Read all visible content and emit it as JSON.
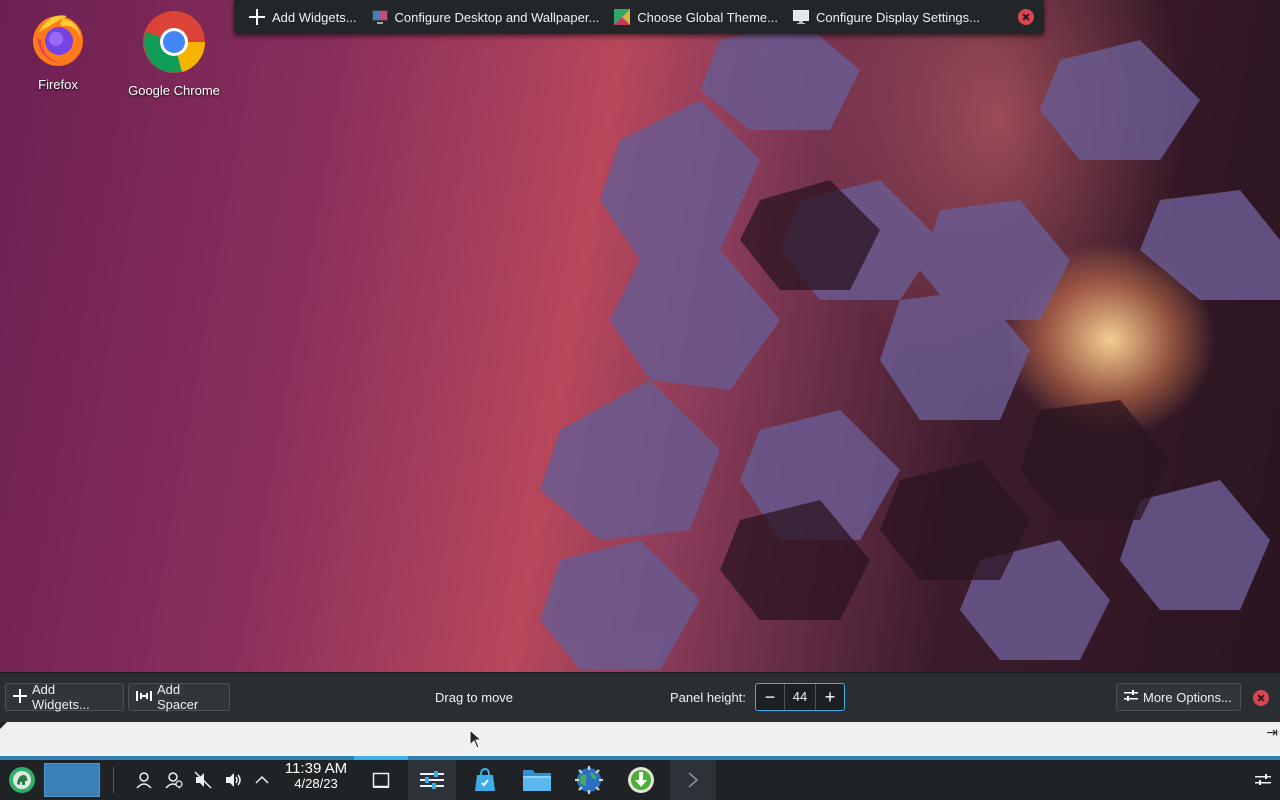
{
  "desktop": {
    "icons": [
      {
        "label": "Firefox",
        "icon": "firefox-icon"
      },
      {
        "label": "Google Chrome",
        "icon": "chrome-icon"
      }
    ]
  },
  "top_toolbar": {
    "add_widgets": "Add Widgets...",
    "configure_desktop": "Configure Desktop and Wallpaper...",
    "global_theme": "Choose Global Theme...",
    "display_settings": "Configure Display Settings..."
  },
  "panel_config": {
    "add_widgets": "Add Widgets...",
    "add_spacer": "Add Spacer",
    "drag_to_move": "Drag to move",
    "panel_height_label": "Panel height:",
    "panel_height_value": "44",
    "more_options": "More Options..."
  },
  "taskbar": {
    "time": "11:39 AM",
    "date": "4/28/23",
    "icons": [
      "app-launcher-icon",
      "pager-icon",
      "user-icon",
      "user-switch-icon",
      "muted-speaker-icon",
      "volume-icon",
      "tray-expand-icon",
      "show-desktop-icon",
      "settings-icon",
      "discover-store-icon",
      "file-manager-icon",
      "browser-icon",
      "download-icon",
      "overflow-chevron-icon",
      "panel-config-icon"
    ]
  },
  "colors": {
    "accent": "#3daee9",
    "panel_bg": "#2a2e32",
    "toolbar_bg": "#232629",
    "close_red": "#da4453"
  }
}
